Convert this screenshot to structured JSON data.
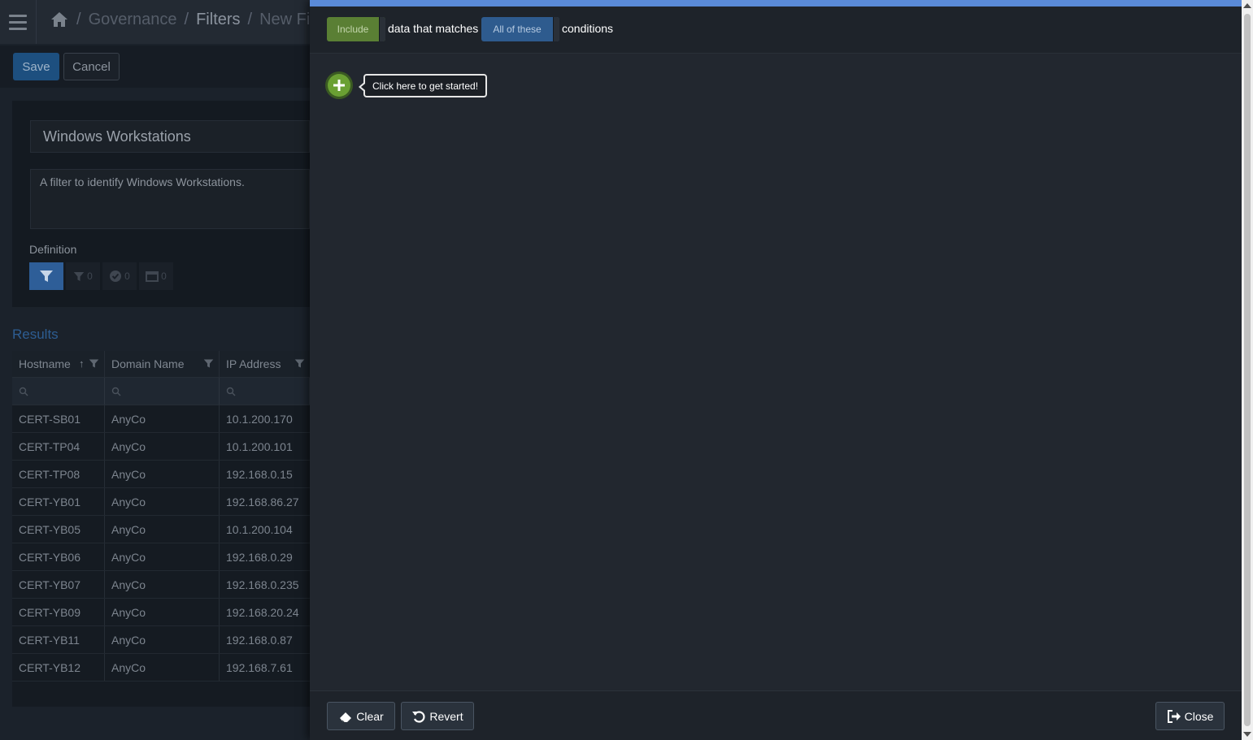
{
  "breadcrumb": {
    "items": [
      "Governance",
      "Filters",
      "New Fil"
    ],
    "separator": "/"
  },
  "toolbar": {
    "save_label": "Save",
    "cancel_label": "Cancel"
  },
  "filter": {
    "name": "Windows Workstations",
    "description": "A filter to identify Windows Workstations.",
    "definition_label": "Definition",
    "tool_counts": [
      "0",
      "0",
      "0"
    ]
  },
  "results": {
    "title": "Results",
    "columns": [
      "Hostname",
      "Domain Name",
      "IP Address"
    ],
    "rows": [
      [
        "CERT-SB01",
        "AnyCo",
        "10.1.200.170"
      ],
      [
        "CERT-TP04",
        "AnyCo",
        "10.1.200.101"
      ],
      [
        "CERT-TP08",
        "AnyCo",
        "192.168.0.15"
      ],
      [
        "CERT-YB01",
        "AnyCo",
        "192.168.86.27"
      ],
      [
        "CERT-YB05",
        "AnyCo",
        "10.1.200.104"
      ],
      [
        "CERT-YB06",
        "AnyCo",
        "192.168.0.29"
      ],
      [
        "CERT-YB07",
        "AnyCo",
        "192.168.0.235"
      ],
      [
        "CERT-YB09",
        "AnyCo",
        "192.168.20.24"
      ],
      [
        "CERT-YB11",
        "AnyCo",
        "192.168.0.87"
      ],
      [
        "CERT-YB12",
        "AnyCo",
        "192.168.7.61"
      ]
    ]
  },
  "condition_builder": {
    "include_label": "Include",
    "text_matches": "data that matches",
    "match_mode": "All of these",
    "text_conditions": "conditions",
    "tooltip": "Click here to get started!"
  },
  "footer": {
    "clear_label": "Clear",
    "revert_label": "Revert",
    "close_label": "Close"
  },
  "colors": {
    "accent_topline": "#5a8ad8",
    "include_green": "#5a7f34",
    "match_blue": "#2e5b8e",
    "add_green": "#6aa033"
  },
  "icons": [
    "menu-icon",
    "home-icon",
    "filter-icon",
    "check-circle-icon",
    "calendar-icon",
    "sort-icon",
    "search-icon",
    "plus-icon",
    "eraser-icon",
    "undo-icon",
    "sign-out-icon"
  ]
}
